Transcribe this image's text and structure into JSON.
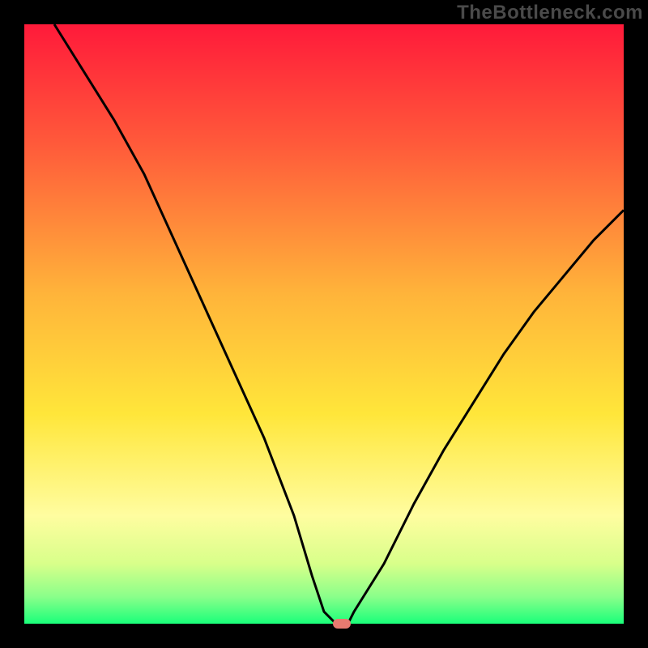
{
  "watermark": "TheBottleneck.com",
  "chart_data": {
    "type": "line",
    "title": "",
    "xlabel": "",
    "ylabel": "",
    "xlim": [
      0,
      100
    ],
    "ylim": [
      0,
      100
    ],
    "grid": false,
    "legend": false,
    "series": [
      {
        "name": "bottleneck-curve",
        "x": [
          5,
          10,
          15,
          20,
          25,
          30,
          35,
          40,
          45,
          48,
          50,
          52,
          54,
          55,
          60,
          65,
          70,
          75,
          80,
          85,
          90,
          95,
          100
        ],
        "y": [
          100,
          92,
          84,
          75,
          64,
          53,
          42,
          31,
          18,
          8,
          2,
          0,
          0,
          2,
          10,
          20,
          29,
          37,
          45,
          52,
          58,
          64,
          69
        ]
      }
    ],
    "marker": {
      "x": 53,
      "y": 0,
      "color": "#e87a70"
    },
    "background_gradient": {
      "stops": [
        {
          "pos": 0.0,
          "color": "#ff1a3a"
        },
        {
          "pos": 0.2,
          "color": "#ff5a3a"
        },
        {
          "pos": 0.45,
          "color": "#ffb43a"
        },
        {
          "pos": 0.65,
          "color": "#ffe63a"
        },
        {
          "pos": 0.82,
          "color": "#fffda0"
        },
        {
          "pos": 0.9,
          "color": "#d8ff8a"
        },
        {
          "pos": 0.955,
          "color": "#8aff8a"
        },
        {
          "pos": 1.0,
          "color": "#1aff7a"
        }
      ]
    }
  }
}
